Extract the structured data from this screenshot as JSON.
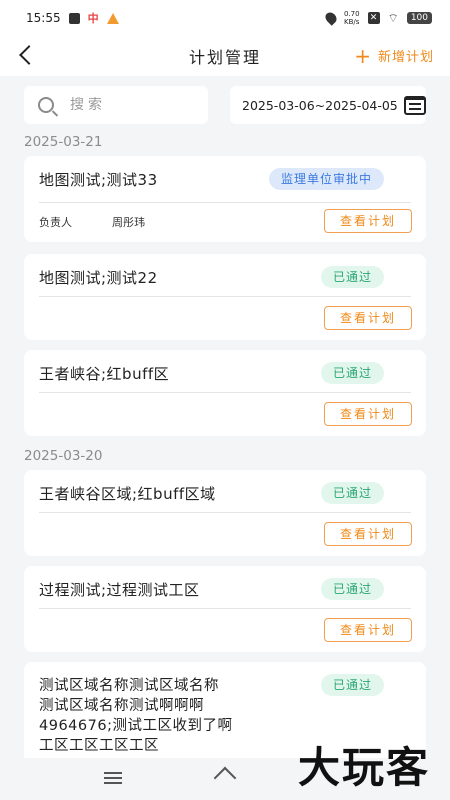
{
  "status_bar": {
    "time": "15:55",
    "carrier_icon": "中",
    "speed": "0.70\nKB/s",
    "battery": "100"
  },
  "nav": {
    "title": "计划管理",
    "add_label": "新增计划"
  },
  "search": {
    "placeholder": "搜索",
    "date_range": "2025-03-06~2025-04-05"
  },
  "groups": [
    {
      "date": "2025-03-21",
      "cards": [
        {
          "title": "地图测试;测试33",
          "status": "监理单位审批中",
          "responsible_label": "负责人",
          "responsible_name": "周彤玮",
          "button": "查看计划"
        },
        {
          "title": "地图测试;测试22",
          "status": "已通过",
          "button": "查看计划"
        },
        {
          "title": "王者峡谷;红buff区",
          "status": "已通过",
          "button": "查看计划"
        }
      ]
    },
    {
      "date": "2025-03-20",
      "cards": [
        {
          "title": "王者峡谷区域;红buff区域",
          "status": "已通过",
          "button": "查看计划"
        },
        {
          "title": "过程测试;过程测试工区",
          "status": "已通过",
          "button": "查看计划"
        },
        {
          "title": "测试区域名称测试区域名称\n测试区域名称测试啊啊啊\n4964676;测试工区收到了啊\n工区工区工区工区",
          "status": "已通过"
        }
      ]
    }
  ],
  "watermark": "大玩客",
  "colors": {
    "accent": "#ef8a1a",
    "pending": "#3c7ae0",
    "approved": "#2aa872"
  }
}
